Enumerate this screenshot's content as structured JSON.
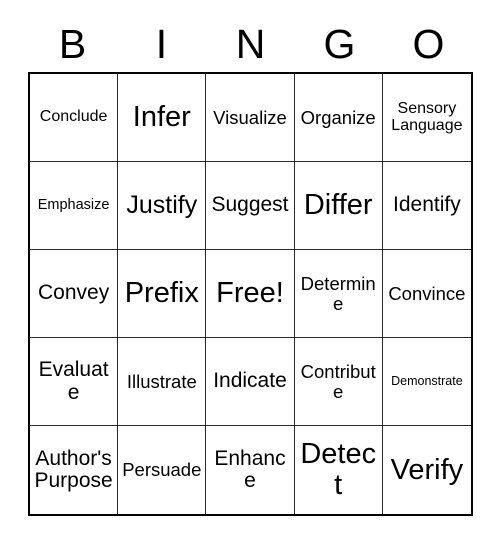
{
  "header": {
    "letters": [
      "B",
      "I",
      "N",
      "G",
      "O"
    ]
  },
  "grid": {
    "rows": 5,
    "columns": 5,
    "cells": [
      {
        "label": "Conclude",
        "size": "s"
      },
      {
        "label": "Infer",
        "size": "xxl"
      },
      {
        "label": "Visualize",
        "size": "m"
      },
      {
        "label": "Organize",
        "size": "m"
      },
      {
        "label": "Sensory Language",
        "size": "s"
      },
      {
        "label": "Emphasize",
        "size": "xs"
      },
      {
        "label": "Justify",
        "size": "xl"
      },
      {
        "label": "Suggest",
        "size": "l"
      },
      {
        "label": "Differ",
        "size": "xxl"
      },
      {
        "label": "Identify",
        "size": "l"
      },
      {
        "label": "Convey",
        "size": "l"
      },
      {
        "label": "Prefix",
        "size": "xxl"
      },
      {
        "label": "Free!",
        "size": "xxl"
      },
      {
        "label": "Determine",
        "size": "m"
      },
      {
        "label": "Convince",
        "size": "m"
      },
      {
        "label": "Evaluate",
        "size": "l"
      },
      {
        "label": "Illustrate",
        "size": "m"
      },
      {
        "label": "Indicate",
        "size": "l"
      },
      {
        "label": "Contribute",
        "size": "m"
      },
      {
        "label": "Demonstrate",
        "size": "xxs"
      },
      {
        "label": "Author's Purpose",
        "size": "l"
      },
      {
        "label": "Persuade",
        "size": "m"
      },
      {
        "label": "Enhance",
        "size": "l"
      },
      {
        "label": "Detect",
        "size": "xxl"
      },
      {
        "label": "Verify",
        "size": "xxl"
      }
    ]
  },
  "colors": {
    "background": "#ffffff",
    "text": "#000000",
    "outer_border": "#000000",
    "inner_border": "#2b2b2b"
  }
}
